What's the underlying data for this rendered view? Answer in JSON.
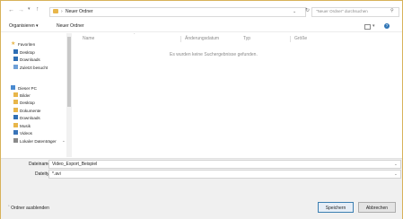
{
  "addressbar": {
    "path_label": "Neuer Ordner",
    "search_placeholder": "\"Neuer Ordner\" durchsuchen"
  },
  "toolbar": {
    "organize": "Organisieren",
    "new_folder": "Neuer Ordner"
  },
  "nav": {
    "favorites": "Favoriten",
    "fav_items": [
      "Desktop",
      "Downloads",
      "Zuletzt besucht"
    ],
    "this_pc": "Dieser PC",
    "pc_items": [
      "Bilder",
      "Desktop",
      "Dokumente",
      "Downloads",
      "Musik",
      "Videos",
      "Lokaler Datenträger"
    ]
  },
  "columns": {
    "name": "Name",
    "modified": "Änderungsdatum",
    "type": "Typ",
    "size": "Größe"
  },
  "content": {
    "empty_message": "Es wurden keine Suchergebnisse gefunden."
  },
  "save": {
    "filename_label": "Dateiname:",
    "filename_value": "Video_Export_Beispiel",
    "filetype_label": "Dateityp:",
    "filetype_value": "*.avi",
    "hide_folders": "Ordner ausblenden",
    "save_button": "Speichern",
    "cancel_button": "Abbrechen"
  },
  "colors": {
    "border": "#d8b25a",
    "folder": "#e8b64a",
    "accent": "#3c7fb1"
  }
}
